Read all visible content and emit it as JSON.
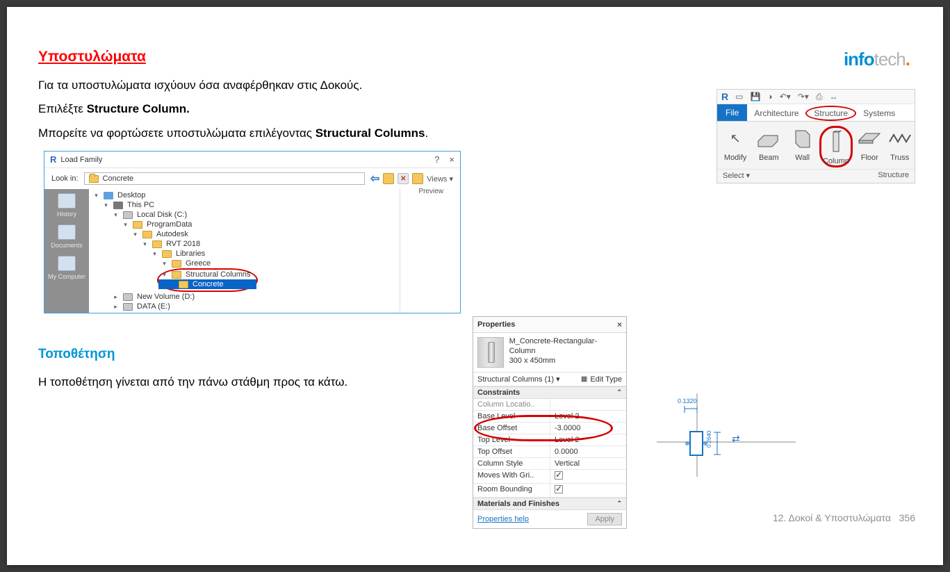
{
  "logo": {
    "part1": "info",
    "part2": "tech",
    "dot": "."
  },
  "heading_red": "Υποστυλώματα",
  "para1": "Για τα υποστυλώματα ισχύουν όσα αναφέρθηκαν στις Δοκούς.",
  "para2_pre": "Επιλέξτε ",
  "para2_strong": "Structure Column.",
  "para3_pre": "Μπορείτε να φορτώσετε υποστυλώματα επιλέγοντας ",
  "para3_strong": "Structural Columns",
  "para3_post": ".",
  "heading_cyan": "Τοποθέτηση",
  "para_cyan_below": "Η τοποθέτηση γίνεται από την πάνω στάθμη προς τα κάτω.",
  "load_family": {
    "title": "Load Family",
    "lookin_label": "Look in:",
    "lookin_value": "Concrete",
    "views_label": "Views",
    "preview_label": "Preview",
    "sidebar": [
      {
        "label": "History"
      },
      {
        "label": "Documents"
      },
      {
        "label": "My Computer"
      }
    ],
    "tree": [
      {
        "indent": 0,
        "icon": "desktop",
        "label": "Desktop"
      },
      {
        "indent": 1,
        "icon": "pc",
        "label": "This PC"
      },
      {
        "indent": 2,
        "icon": "disk",
        "label": "Local Disk (C:)"
      },
      {
        "indent": 3,
        "icon": "folder",
        "label": "ProgramData"
      },
      {
        "indent": 4,
        "icon": "folder",
        "label": "Autodesk"
      },
      {
        "indent": 5,
        "icon": "folder",
        "label": "RVT 2018"
      },
      {
        "indent": 6,
        "icon": "folder",
        "label": "Libraries"
      },
      {
        "indent": 7,
        "icon": "folder",
        "label": "Greece"
      }
    ],
    "circled_item": "Structural Columns",
    "selected_item": "Concrete",
    "tree_after": [
      {
        "indent": 2,
        "icon": "disk",
        "label": "New Volume (D:)"
      },
      {
        "indent": 2,
        "icon": "disk",
        "label": "DATA (E:)"
      }
    ]
  },
  "ribbon": {
    "tabs": {
      "file": "File",
      "arch": "Architecture",
      "struct": "Structure",
      "sys": "Systems"
    },
    "items": {
      "modify": "Modify",
      "beam": "Beam",
      "wall": "Wall",
      "column": "Column",
      "floor": "Floor",
      "truss": "Truss"
    },
    "select": "Select ▾",
    "group": "Structure"
  },
  "properties": {
    "title": "Properties",
    "type_line1": "M_Concrete-Rectangular-Column",
    "type_line2": "300 x 450mm",
    "selector": "Structural Columns (1)",
    "edit_type": "Edit Type",
    "group_constraints": "Constraints",
    "group_materials": "Materials and Finishes",
    "rows": [
      {
        "l": "Column Locatio..",
        "r": "",
        "muted": true
      },
      {
        "l": "Base Level",
        "r": "Level 2"
      },
      {
        "l": "Base Offset",
        "r": "-3.0000"
      },
      {
        "l": "Top Level",
        "r": "Level 2"
      },
      {
        "l": "Top Offset",
        "r": "0.0000"
      },
      {
        "l": "Column Style",
        "r": "Vertical"
      },
      {
        "l": "Moves With Gri..",
        "r": "",
        "check": true
      },
      {
        "l": "Room Bounding",
        "r": "",
        "check": true
      }
    ],
    "help": "Properties help",
    "apply": "Apply"
  },
  "drawing": {
    "dim_top": "0.1320",
    "dim_side": "0.2640"
  },
  "footer": {
    "chapter": "12. Δοκοί & Υποστυλώματα",
    "page": "356"
  }
}
